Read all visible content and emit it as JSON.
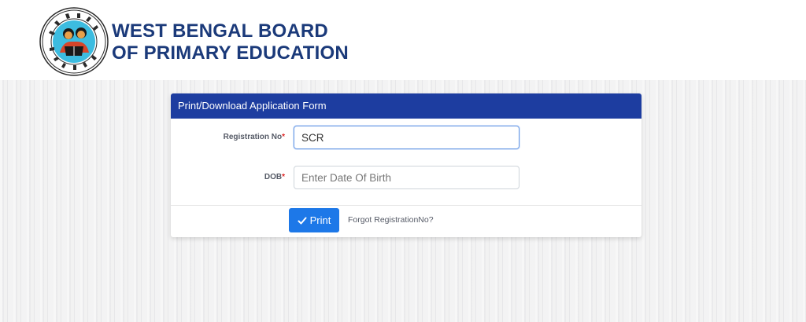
{
  "header": {
    "logo_text": "পশ্চিমবঙ্গ প্রাথমিক শিক্ষা পর্ষদ · WB BOARD OF PRIMARY EDUCATION",
    "brand_line1": "WEST BENGAL BOARD",
    "brand_line2": "OF PRIMARY EDUCATION"
  },
  "form": {
    "title": "Print/Download Application Form",
    "registration": {
      "label": "Registration No",
      "required_mark": "*",
      "value": "SCR"
    },
    "dob": {
      "label": "DOB",
      "required_mark": "*",
      "placeholder": "Enter Date Of Birth",
      "value": ""
    },
    "print_button": "Print",
    "forgot_link": "Forgot RegistrationNo?"
  },
  "colors": {
    "brand": "#1b3a7a",
    "card_header": "#1d3da0",
    "button": "#1d78e8",
    "required": "#dd2222"
  },
  "icons": {
    "print_button_icon": "check-icon"
  }
}
